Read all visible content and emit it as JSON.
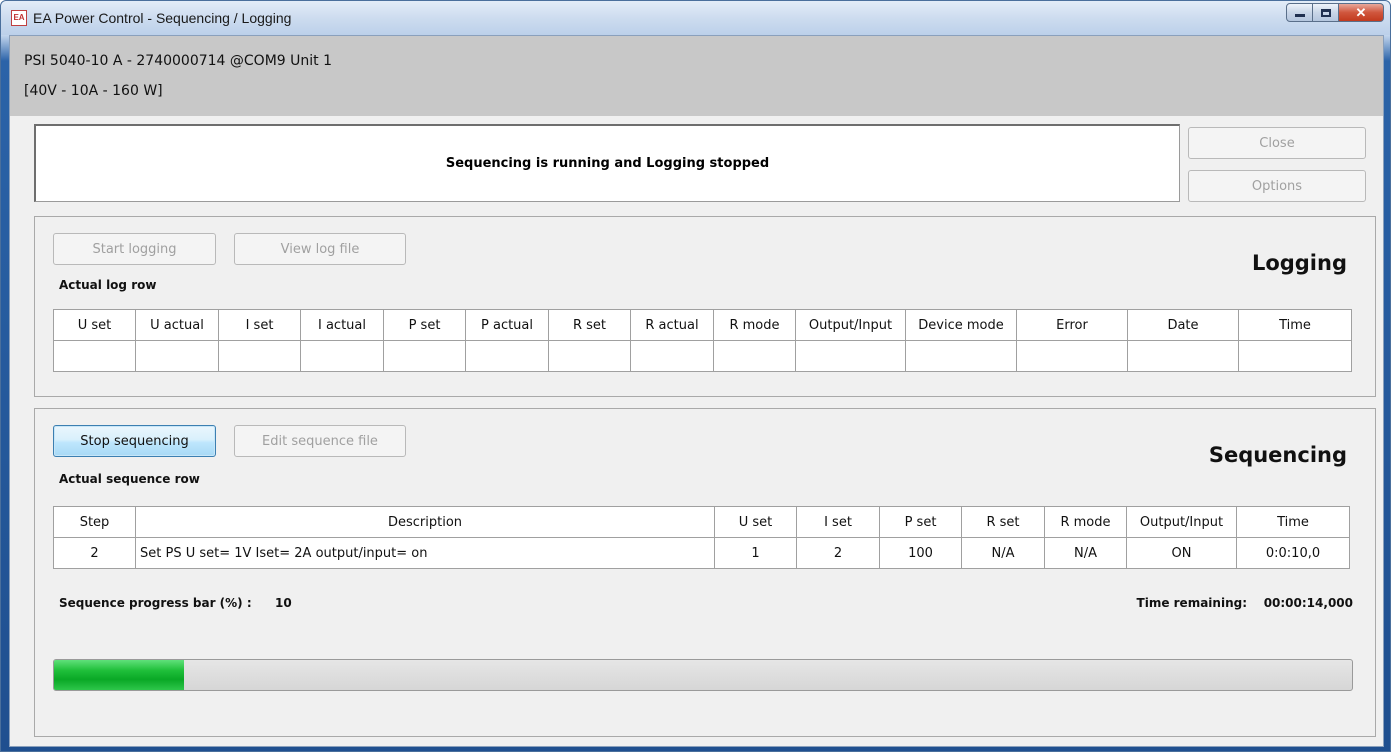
{
  "window": {
    "title": "EA Power Control - Sequencing / Logging",
    "icon_text": "EA"
  },
  "device": {
    "line1": "PSI 5040-10 A - 2740000714 @COM9 Unit 1",
    "line2": "[40V - 10A - 160 W]"
  },
  "status": {
    "message": "Sequencing is running and Logging stopped"
  },
  "side_buttons": {
    "close_label": "Close",
    "options_label": "Options"
  },
  "logging": {
    "title": "Logging",
    "start_label": "Start logging",
    "view_label": "View log file",
    "caption": "Actual log row",
    "columns": [
      "U set",
      "U actual",
      "I set",
      "I actual",
      "P set",
      "P actual",
      "R set",
      "R actual",
      "R mode",
      "Output/Input",
      "Device mode",
      "Error",
      "Date",
      "Time"
    ],
    "row": [
      "",
      "",
      "",
      "",
      "",
      "",
      "",
      "",
      "",
      "",
      "",
      "",
      "",
      ""
    ]
  },
  "sequencing": {
    "title": "Sequencing",
    "stop_label": "Stop sequencing",
    "edit_label": "Edit sequence file",
    "caption": "Actual sequence row",
    "columns": [
      "Step",
      "Description",
      "U set",
      "I set",
      "P set",
      "R set",
      "R mode",
      "Output/Input",
      "Time"
    ],
    "row": [
      "2",
      "Set PS U set= 1V Iset= 2A output/input= on",
      "1",
      "2",
      "100",
      "N/A",
      "N/A",
      "ON",
      "0:0:10,0"
    ],
    "progress_label": "Sequence progress bar (%) :",
    "progress_value": "10",
    "progress_percent": 10,
    "time_remaining_label": "Time remaining:",
    "time_remaining_value": "00:00:14,000"
  },
  "colors": {
    "progress_green": "#1fbf3a",
    "header_gray": "#c8c8c8",
    "titlebar_blue": "#2b63a8"
  }
}
